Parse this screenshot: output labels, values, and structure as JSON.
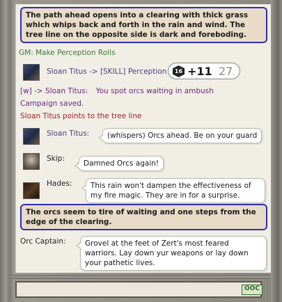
{
  "chat": {
    "story1": "The path ahead opens into a clearing with thick grass which whips back and forth in the rain and wind.  The tree line on the opposite side is dark and foreboding.",
    "gm_line": "GM:   Make Perception Rolls",
    "roll": {
      "label": "Sloan Titus -> [SKILL] Perception",
      "die_face": "16",
      "modifier": "+11",
      "total": "27"
    },
    "whisper": {
      "prefix": "[w] -> Sloan Titus:",
      "text": "You spot orcs waiting in ambush"
    },
    "campaign_saved": "Campaign saved.",
    "emote": "Sloan Titus points to the tree line",
    "msg_sloan": {
      "speaker": "Sloan Titus:",
      "text": "(whispers) Orcs ahead. Be on your guard"
    },
    "msg_skip": {
      "speaker": "Skip:",
      "text": "Damned Orcs again!"
    },
    "msg_hades": {
      "speaker": "Hades:",
      "text": "This rain won't dampen the effectiveness of my fire magic.  They are in for a surprise."
    },
    "story2": "The orcs seem to tire of waiting and one steps from the edge of the clearing.",
    "msg_captain": {
      "speaker": "Orc Captain:",
      "text": "Grovel at the feet of Zert's most feared warriors. Lay down yur weapons or lay down your pathetic lives."
    }
  },
  "input": {
    "placeholder": "",
    "ooc_label": "OOC"
  },
  "colors": {
    "story_border": "#2b2fb0",
    "gm": "#3b7a3b",
    "whisper": "#6a2a7a",
    "emote": "#9a2424"
  }
}
